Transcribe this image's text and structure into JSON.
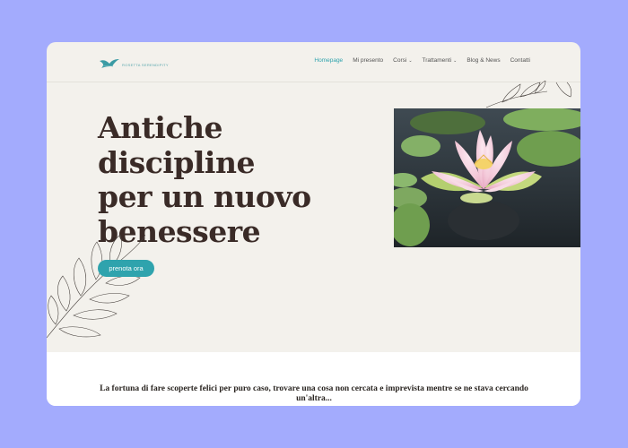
{
  "brand": {
    "name": "ROSETTA SERENDIPITY",
    "accent": "#2fa3ad",
    "background": "#f3f1ec",
    "outer_background": "#a3abfd"
  },
  "nav": {
    "items": [
      {
        "label": "Homepage",
        "active": true,
        "has_dropdown": false
      },
      {
        "label": "Mi presento",
        "active": false,
        "has_dropdown": false
      },
      {
        "label": "Corsi",
        "active": false,
        "has_dropdown": true
      },
      {
        "label": "Trattamenti",
        "active": false,
        "has_dropdown": true
      },
      {
        "label": "Blog & News",
        "active": false,
        "has_dropdown": false
      },
      {
        "label": "Contatti",
        "active": false,
        "has_dropdown": false
      }
    ],
    "dropdown_icon": "chevron-down-icon"
  },
  "hero": {
    "title_lines": [
      "Antiche",
      "discipline",
      "per un nuovo",
      "benessere"
    ],
    "cta_label": "prenota ora",
    "image_subject": "lotus-flower"
  },
  "quote": {
    "text": "La fortuna di fare scoperte felici per puro caso, trovare una cosa non cercata e imprevista mentre se ne stava cercando un'altra..."
  }
}
